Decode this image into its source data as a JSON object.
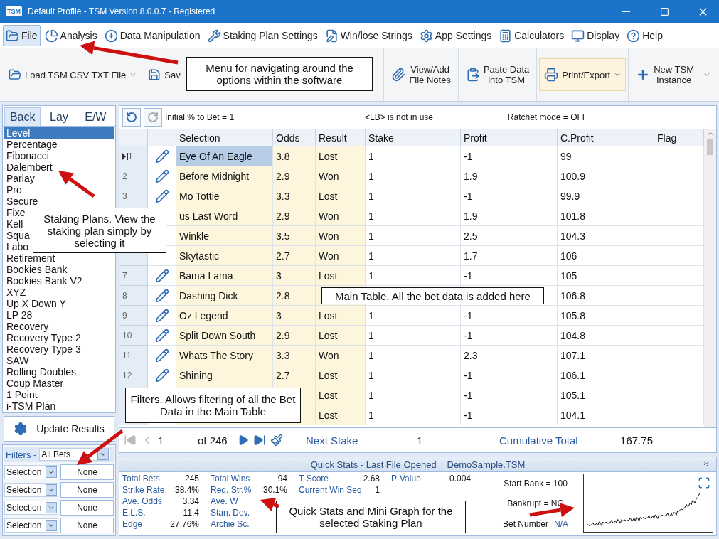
{
  "window": {
    "badge": "TSM",
    "title": "Default Profile  - TSM Version 8.0.0.7 - Registered"
  },
  "menu": [
    {
      "label": "File",
      "selected": true
    },
    {
      "label": "Analysis",
      "selected": false
    },
    {
      "label": "Data Manipulation",
      "selected": false
    },
    {
      "label": "Staking Plan Settings",
      "selected": false
    },
    {
      "label": "Win/lose Strings",
      "selected": false
    },
    {
      "label": "App Settings",
      "selected": false
    },
    {
      "label": "Calculators",
      "selected": false
    },
    {
      "label": "Display",
      "selected": false
    },
    {
      "label": "Help",
      "selected": false
    }
  ],
  "toolbar": [
    {
      "label": "Load TSM CSV TXT File",
      "dropdown": true,
      "highlighted": false
    },
    {
      "label": "Sav",
      "dropdown": false,
      "highlighted": false
    },
    {
      "label": "View/Add\nFile Notes",
      "dropdown": false,
      "highlighted": false
    },
    {
      "label": "Paste Data\ninto TSM",
      "dropdown": false,
      "highlighted": false
    },
    {
      "label": "Print/Export",
      "dropdown": true,
      "highlighted": true
    },
    {
      "label": "New TSM\nInstance",
      "dropdown": true,
      "highlighted": false
    }
  ],
  "plan_tabs": [
    {
      "label": "Back",
      "selected": true
    },
    {
      "label": "Lay",
      "selected": false
    },
    {
      "label": "E/W",
      "selected": false
    }
  ],
  "staking_plans": [
    {
      "label": "Level",
      "selected": true
    },
    {
      "label": "Percentage",
      "selected": false
    },
    {
      "label": "Fibonacci",
      "selected": false
    },
    {
      "label": "Dalembert",
      "selected": false
    },
    {
      "label": "Parlay",
      "selected": false
    },
    {
      "label": "Pro",
      "selected": false
    },
    {
      "label": "Secure",
      "selected": false
    },
    {
      "label": "Fixe",
      "selected": false
    },
    {
      "label": "Kell",
      "selected": false
    },
    {
      "label": "Squa",
      "selected": false
    },
    {
      "label": "Labo",
      "selected": false
    },
    {
      "label": "Retirement",
      "selected": false
    },
    {
      "label": "Bookies Bank",
      "selected": false
    },
    {
      "label": "Bookies Bank V2",
      "selected": false
    },
    {
      "label": "XYZ",
      "selected": false
    },
    {
      "label": "Up X Down Y",
      "selected": false
    },
    {
      "label": "LP 28",
      "selected": false
    },
    {
      "label": "Recovery",
      "selected": false
    },
    {
      "label": "Recovery Type 2",
      "selected": false
    },
    {
      "label": "Recovery Type 3",
      "selected": false
    },
    {
      "label": "SAW",
      "selected": false
    },
    {
      "label": "Rolling Doubles",
      "selected": false
    },
    {
      "label": "Coup Master",
      "selected": false
    },
    {
      "label": "1 Point",
      "selected": false
    },
    {
      "label": "i-TSM Plan",
      "selected": false
    }
  ],
  "update_button": "Update Results",
  "filters": {
    "label": "Filters -",
    "value": "All Bets",
    "rows": [
      {
        "field": "Selection",
        "value": "None"
      },
      {
        "field": "Selection",
        "value": "None"
      },
      {
        "field": "Selection",
        "value": "None"
      },
      {
        "field": "Selection",
        "value": "None"
      }
    ]
  },
  "stake_bar": {
    "initial": "Initial % to Bet = 1",
    "lb": "<LB> is not in use",
    "ratchet": "Ratchet mode = OFF"
  },
  "table": {
    "columns": [
      "Selection",
      "Odds",
      "Result",
      "Stake",
      "Profit",
      "C.Profit",
      "Flag"
    ],
    "rows": [
      {
        "number": "1",
        "current": true,
        "selected": true,
        "pencil": true,
        "selection": "Eye Of An Eagle",
        "odds": "3.8",
        "result": "Lost",
        "stake": "1",
        "profit": "-1",
        "cprofit": "99"
      },
      {
        "number": "2",
        "current": false,
        "selected": false,
        "pencil": true,
        "selection": "Before Midnight",
        "odds": "2.9",
        "result": "Won",
        "stake": "1",
        "profit": "1.9",
        "cprofit": "100.9"
      },
      {
        "number": "3",
        "current": false,
        "selected": false,
        "pencil": true,
        "selection": "Mo Tottie",
        "odds": "3.3",
        "result": "Lost",
        "stake": "1",
        "profit": "-1",
        "cprofit": "99.9"
      },
      {
        "selected": false,
        "pencil": false,
        "selection": "us Last Word",
        "odds": "2.9",
        "result": "Won",
        "stake": "1",
        "profit": "1.9",
        "cprofit": "101.8"
      },
      {
        "selected": false,
        "pencil": false,
        "selection": "Winkle",
        "odds": "3.5",
        "result": "Won",
        "stake": "1",
        "profit": "2.5",
        "cprofit": "104.3"
      },
      {
        "current": false,
        "selected": false,
        "pencil": false,
        "selection": "Skytastic",
        "odds": "2.7",
        "result": "Won",
        "stake": "1",
        "profit": "1.7",
        "cprofit": "106"
      },
      {
        "number": "7",
        "current": false,
        "selected": false,
        "pencil": true,
        "selection": "Bama Lama",
        "odds": "3",
        "result": "Lost",
        "stake": "1",
        "profit": "-1",
        "cprofit": "105"
      },
      {
        "number": "8",
        "current": false,
        "selected": false,
        "pencil": true,
        "selection": "Dashing Dick",
        "odds": "2.8",
        "cprofit": "106.8"
      },
      {
        "number": "9",
        "current": false,
        "selected": false,
        "pencil": true,
        "selection": "Oz Legend",
        "odds": "3",
        "result": "Lost",
        "stake": "1",
        "profit": "-1",
        "cprofit": "105.8"
      },
      {
        "number": "10",
        "current": false,
        "selected": false,
        "pencil": true,
        "selection": "Split Down South",
        "odds": "2.9",
        "result": "Lost",
        "stake": "1",
        "profit": "-1",
        "cprofit": "104.8"
      },
      {
        "number": "11",
        "current": false,
        "selected": false,
        "pencil": true,
        "selection": "Whats The Story",
        "odds": "3.3",
        "result": "Won",
        "stake": "1",
        "profit": "2.3",
        "cprofit": "107.1"
      },
      {
        "number": "12",
        "current": false,
        "selected": false,
        "pencil": true,
        "selection": "Shining",
        "odds": "2.7",
        "result": "Lost",
        "stake": "1",
        "profit": "-1",
        "cprofit": "106.1"
      },
      {
        "result": "Lost",
        "stake": "1",
        "profit": "-1",
        "cprofit": "105.1"
      },
      {
        "result": "Lost",
        "stake": "1",
        "profit": "-1",
        "cprofit": "104.1"
      }
    ]
  },
  "navigator": {
    "page": "1",
    "of": "of 246",
    "next_stake_label": "Next Stake",
    "next_stake": "1",
    "cumulative_label": "Cumulative Total",
    "cumulative": "167.75"
  },
  "quick_stats": {
    "title": "Quick Stats - Last File Opened = DemoSample.TSM",
    "groups": [
      [
        {
          "label": "Total Bets",
          "value": "245"
        },
        {
          "label": "Strike Rate",
          "value": "38.4%"
        },
        {
          "label": "Ave. Odds",
          "value": "3.34"
        },
        {
          "label": "E.L.S.",
          "value": "11.4"
        },
        {
          "label": "Edge",
          "value": "27.76%"
        }
      ],
      [
        {
          "label": "Total Wins",
          "value": "94"
        },
        {
          "label": "Req. Str.%",
          "value": "30.1%"
        },
        {
          "label": "Ave. W"
        },
        {
          "label": "Stan. Dev."
        },
        {
          "label": "Archie Sc."
        }
      ],
      [
        {
          "label": "T-Score",
          "value": "2.68"
        },
        {
          "label": "Current Win Seq",
          "value": "1"
        }
      ],
      [
        {
          "label": "P-Value",
          "value": "0.004"
        }
      ]
    ],
    "start_bank": "Start Bank = 100",
    "bankrupt": "Bankrupt = NO",
    "bet_number_label": "Bet Number",
    "bet_number": "N/A"
  },
  "callouts": [
    "Menu for navigating around the options within the software",
    "Staking Plans. View the staking plan simply by selecting it",
    "Main Table. All the bet data is added here",
    "Filters. Allows filtering of all the Bet Data in the Main Table",
    "Quick Stats and Mini Graph for the selected Staking Plan"
  ]
}
